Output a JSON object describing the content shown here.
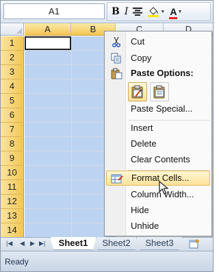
{
  "namebox": {
    "value": "A1"
  },
  "toolbar": {
    "bold": "B",
    "italic": "I",
    "font_color_letter": "A"
  },
  "columns": [
    "A",
    "B",
    "C",
    "D"
  ],
  "rows": [
    "1",
    "2",
    "3",
    "4",
    "5",
    "6",
    "7",
    "8",
    "9",
    "10",
    "11",
    "12",
    "13",
    "14"
  ],
  "menu": {
    "cut": "Cut",
    "copy": "Copy",
    "paste_options": "Paste Options:",
    "paste_special": "Paste Special...",
    "insert": "Insert",
    "delete": "Delete",
    "clear_contents": "Clear Contents",
    "format_cells": "Format Cells...",
    "column_width": "Column Width...",
    "hide": "Hide",
    "unhide": "Unhide"
  },
  "sheets": [
    "Sheet1",
    "Sheet2",
    "Sheet3"
  ],
  "status": {
    "text": "Ready"
  },
  "colors": {
    "selection": "#bcd4f2",
    "header_selected": "#f2c652",
    "highlight": "#fde39a"
  }
}
